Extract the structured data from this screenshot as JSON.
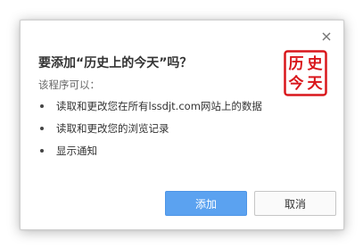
{
  "dialog": {
    "title": "要添加“历史上的今天”吗？",
    "subtitle": "该程序可以：",
    "permissions": [
      "读取和更改您在所有lssdjt.com网站上的数据",
      "读取和更改您的浏览记录",
      "显示通知"
    ],
    "add_label": "添加",
    "cancel_label": "取消",
    "seal": {
      "chars": [
        "历",
        "史",
        "今",
        "天"
      ],
      "color": "#d9161b"
    }
  },
  "colors": {
    "primary_button": "#5ba2f0",
    "title_text": "#333333"
  },
  "icons": {
    "close": "close-icon"
  }
}
